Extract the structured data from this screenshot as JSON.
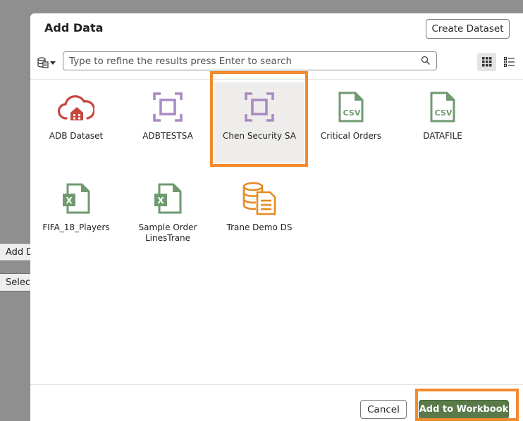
{
  "background": {
    "strip1_text": "Add D",
    "strip2_text": "Selec"
  },
  "dialog": {
    "title": "Add Data",
    "create_dataset_label": "Create Dataset"
  },
  "search": {
    "placeholder": "Type to refine the results press Enter to search",
    "value": ""
  },
  "view_mode": "grid",
  "items": [
    {
      "label": "ADB Dataset",
      "icon": "cloud-database-icon",
      "selected": false
    },
    {
      "label": "ADBTESTSA",
      "icon": "subject-area-icon",
      "selected": false
    },
    {
      "label": "Chen Security SA",
      "icon": "subject-area-icon",
      "selected": true
    },
    {
      "label": "Critical Orders",
      "icon": "csv-file-icon",
      "selected": false
    },
    {
      "label": "DATAFILE",
      "icon": "csv-file-icon",
      "selected": false
    },
    {
      "label": "FIFA_18_Players",
      "icon": "excel-file-icon",
      "selected": false
    },
    {
      "label": "Sample Order LinesTrane",
      "icon": "excel-file-icon",
      "selected": false
    },
    {
      "label": "Trane Demo DS",
      "icon": "database-dataset-icon",
      "selected": false
    }
  ],
  "footer": {
    "cancel_label": "Cancel",
    "add_label": "Add to Workbook"
  },
  "colors": {
    "highlight": "#f28a2e",
    "primary_button": "#5a7a4a",
    "subject_area": "#a98bc4",
    "file_green": "#6f9a70",
    "cloud_red": "#c8473c",
    "dataset_orange": "#e8891e"
  }
}
